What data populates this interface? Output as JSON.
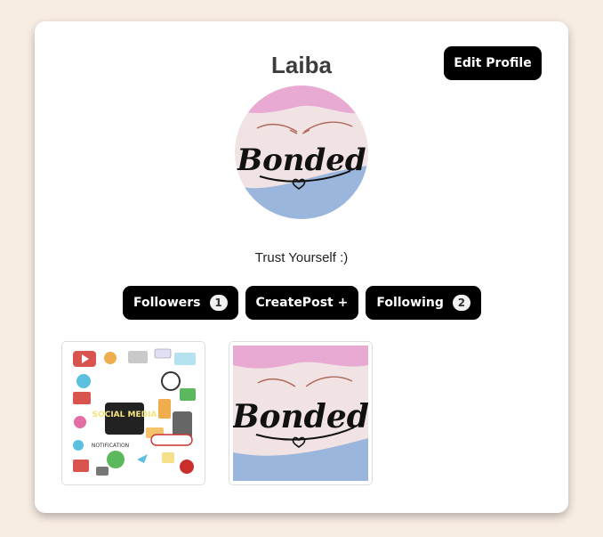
{
  "profile": {
    "username": "Laiba",
    "bio": "Trust Yourself :)",
    "edit_label": "Edit Profile",
    "avatar_logo_text": "Bonded"
  },
  "actions": {
    "followers_label": "Followers",
    "followers_count": "1",
    "create_post_label": "CreatePost +",
    "following_label": "Following",
    "following_count": "2"
  },
  "posts": [
    {
      "title": "SOCIAL MEDIA",
      "subtitle": "NOTIFICATION"
    },
    {
      "title": "Bonded"
    }
  ],
  "colors": {
    "page_bg": "#f8ede3",
    "card_bg": "#ffffff",
    "button_bg": "#000000",
    "logo_pink": "#e8a9d3",
    "logo_blue": "#9bb6dc",
    "logo_cream": "#f1e3e3"
  }
}
